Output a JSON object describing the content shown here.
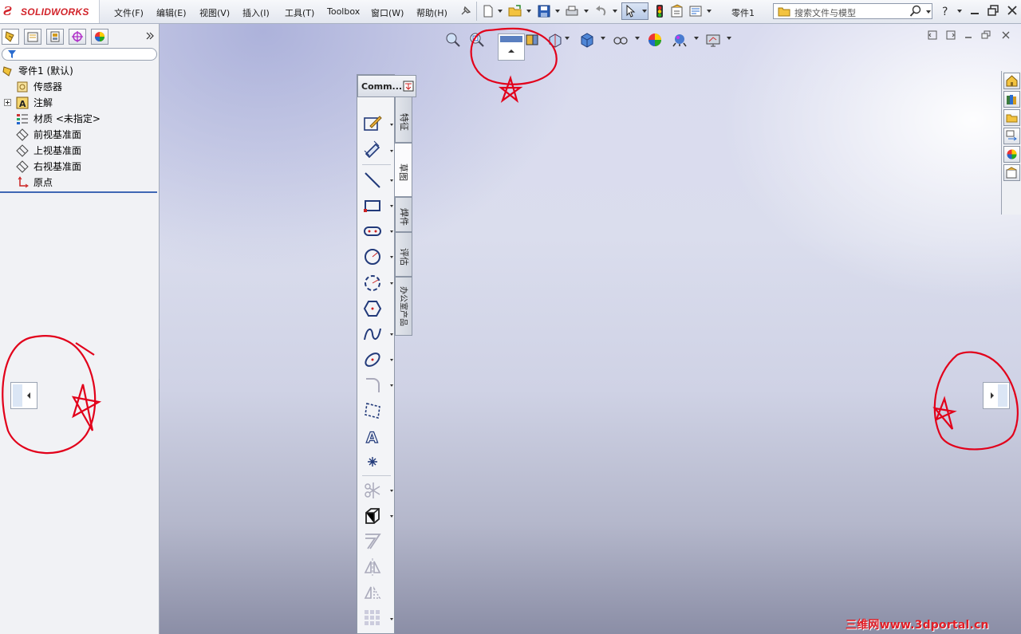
{
  "app": {
    "logo_text": "SOLIDWORKS",
    "brand_color": "#d2232a"
  },
  "menu": {
    "file": "文件(F)",
    "edit": "编辑(E)",
    "view": "视图(V)",
    "insert": "插入(I)",
    "tools": "工具(T)",
    "toolbox": "Toolbox",
    "window": "窗口(W)",
    "help": "帮助(H)"
  },
  "document": {
    "title": "零件1"
  },
  "search": {
    "placeholder": "搜索文件与模型"
  },
  "feature_tree": {
    "root": "零件1  (默认)",
    "items": [
      {
        "label": "传感器",
        "icon": "sensor-icon"
      },
      {
        "label": "注解",
        "icon": "annotation-icon"
      },
      {
        "label": "材质 <未指定>",
        "icon": "material-icon"
      },
      {
        "label": "前视基准面",
        "icon": "plane-icon"
      },
      {
        "label": "上视基准面",
        "icon": "plane-icon"
      },
      {
        "label": "右视基准面",
        "icon": "plane-icon"
      },
      {
        "label": "原点",
        "icon": "origin-icon"
      }
    ]
  },
  "command_manager": {
    "title": "Comm...",
    "tabs": [
      {
        "label": "特征",
        "active": false
      },
      {
        "label": "草图",
        "active": true
      },
      {
        "label": "焊件",
        "active": false
      },
      {
        "label": "评估",
        "active": false
      },
      {
        "label": "办公室产品",
        "active": false
      }
    ]
  },
  "watermark": {
    "text": "三维网www.3dportal.cn"
  },
  "colors": {
    "annotation_red": "#e2001a",
    "selection_blue": "#3f67b4"
  }
}
